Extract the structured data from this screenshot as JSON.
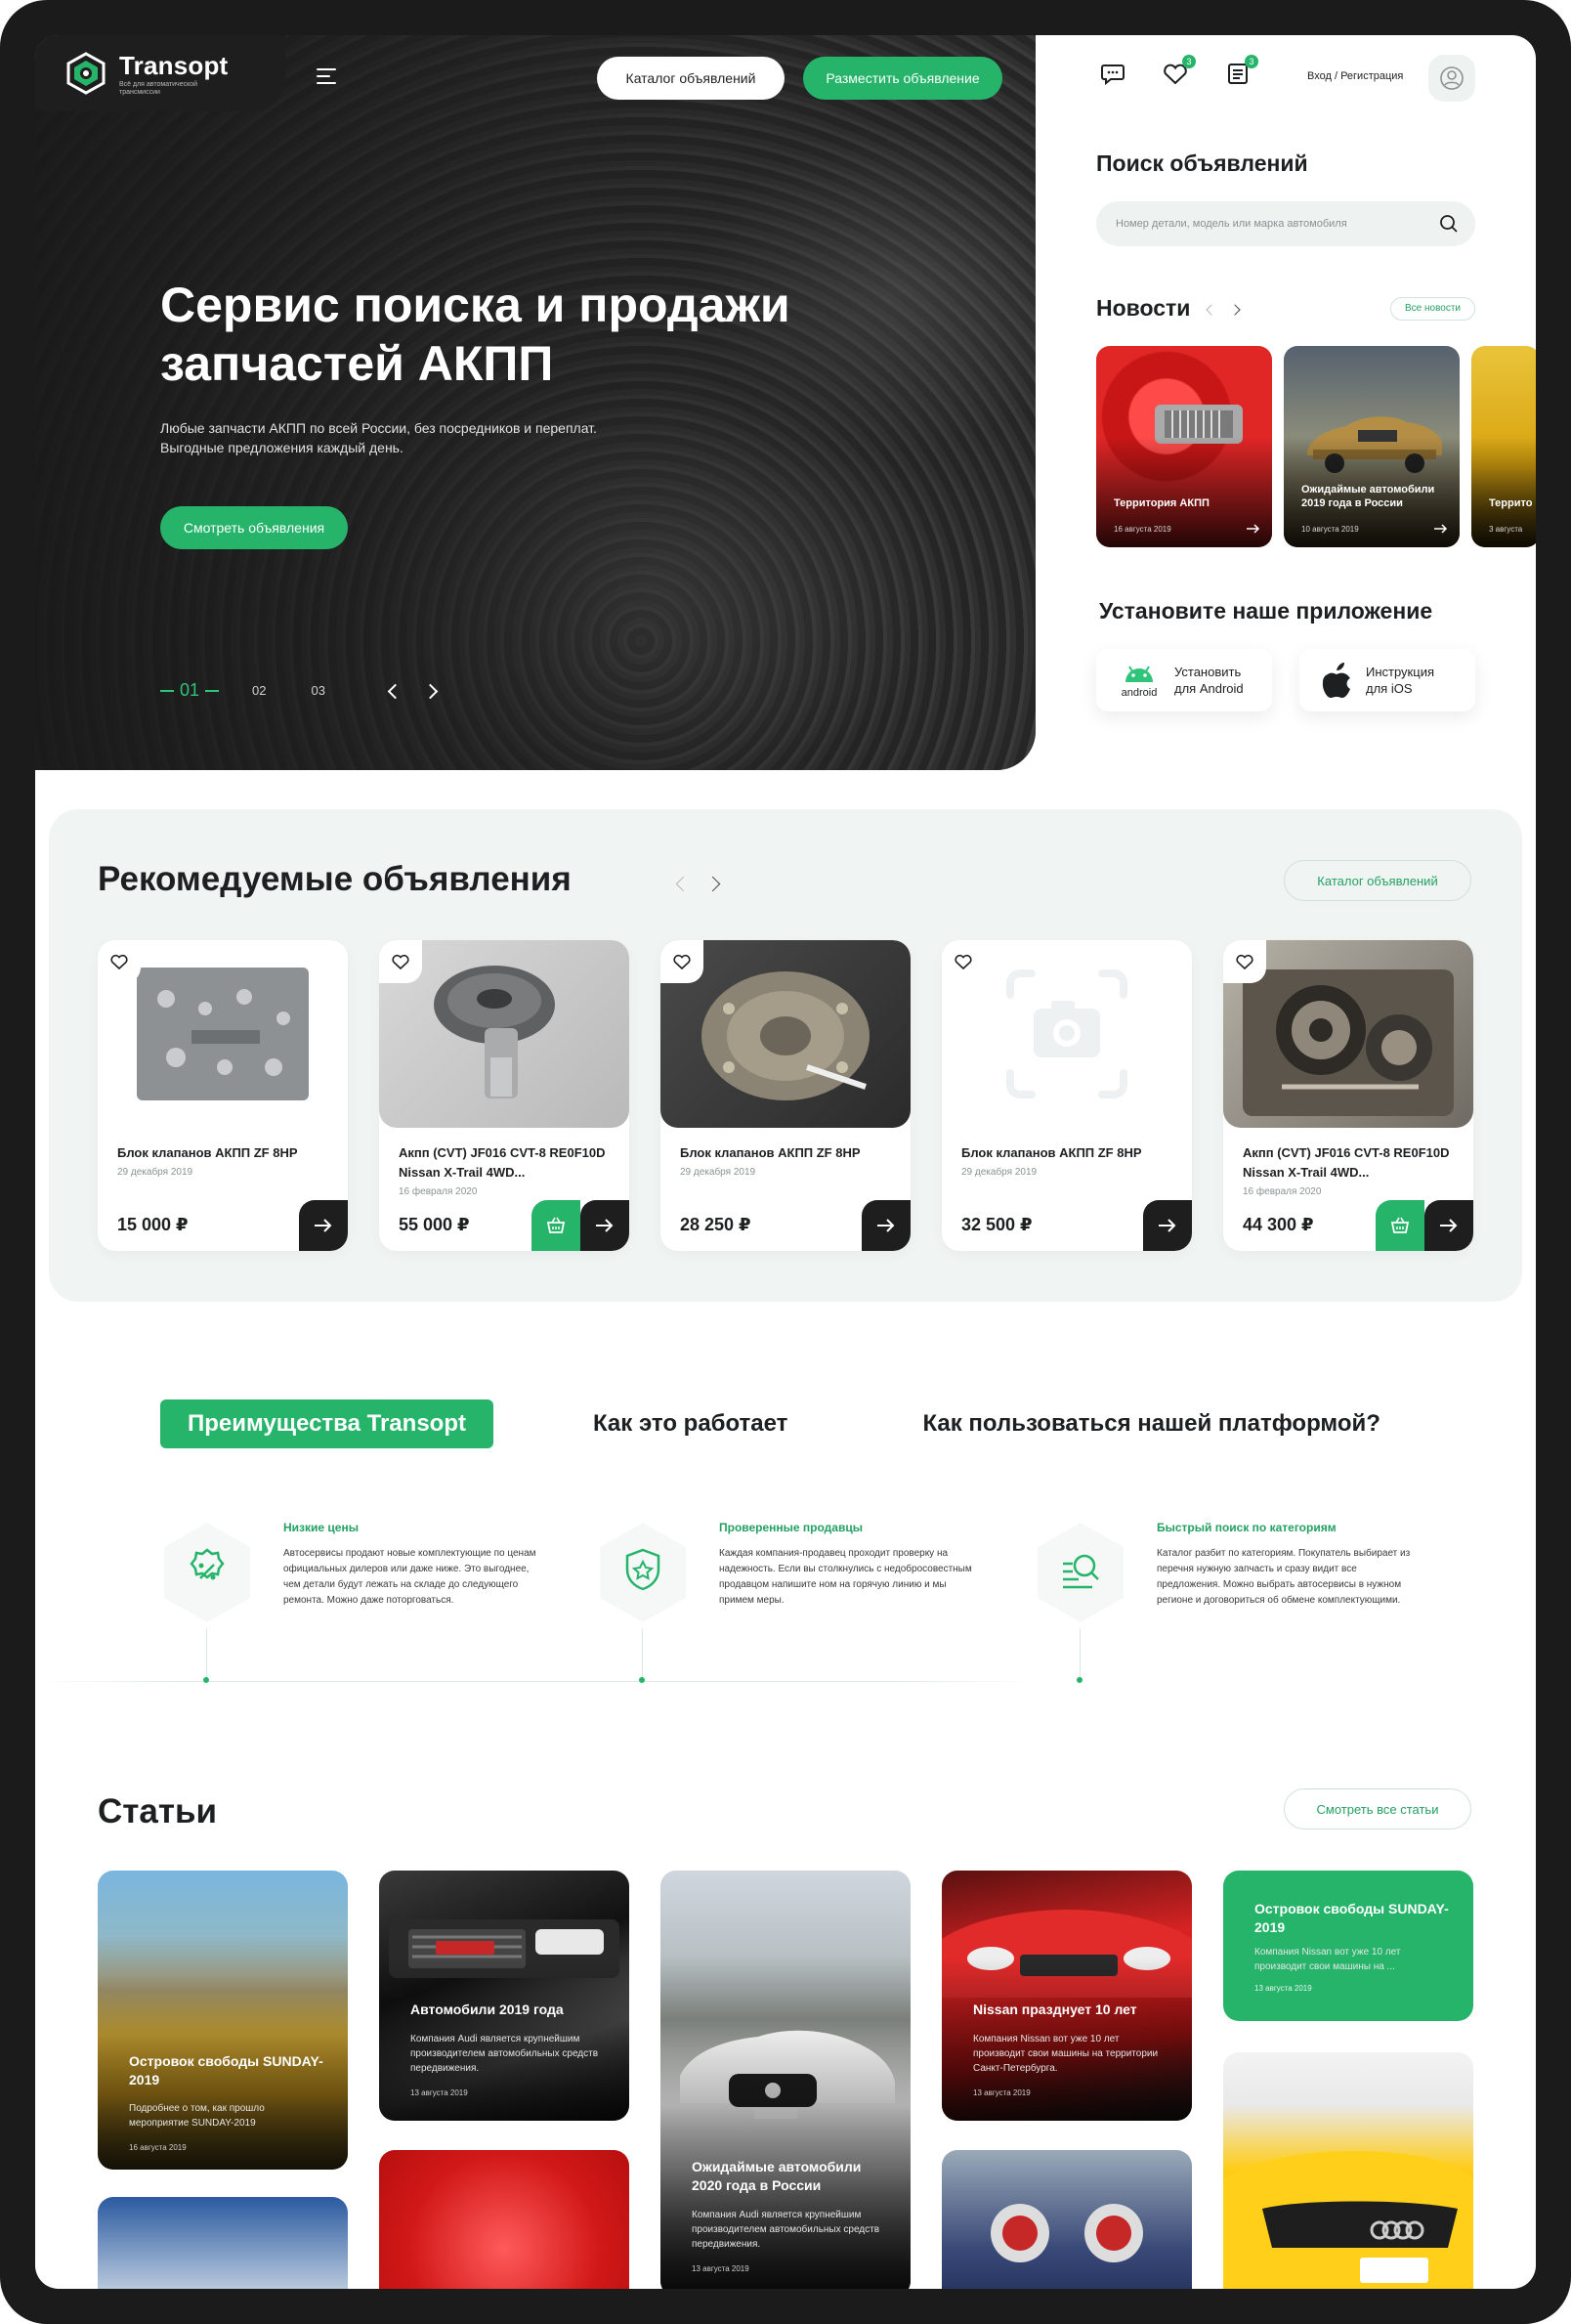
{
  "brand": {
    "name": "Transopt",
    "tagline": "Всё для автоматической трансмиссии",
    "accent": "#25b46a",
    "dark": "#1e1e1e"
  },
  "header": {
    "catalog_btn": "Каталог объявлений",
    "post_btn": "Разместить объявление",
    "icons": [
      "chat-icon",
      "heart-icon",
      "list-icon"
    ],
    "favorites_count": "3",
    "list_count": "3",
    "login_label": "Вход",
    "divider": "/",
    "register_label": "Регистрация"
  },
  "hero": {
    "title": "Сервис поиска и продажи запчастей АКПП",
    "subtitle": "Любые запчасти АКПП по всей России, без посредников и переплат. Выгодные предложения каждый день.",
    "cta": "Смотреть объявления",
    "slides": [
      "01",
      "02",
      "03"
    ],
    "active_slide": "01"
  },
  "search": {
    "title": "Поиск объявлений",
    "placeholder": "Номер детали, модель или марка автомобиля"
  },
  "news": {
    "title": "Новости",
    "all_label": "Все новости",
    "items": [
      {
        "title": "Территория АКПП",
        "date": "16 августа 2019"
      },
      {
        "title": "Ожидаймые автомобили 2019 года в России",
        "date": "10 августа 2019"
      },
      {
        "title": "Террито",
        "date": "3 августа"
      }
    ]
  },
  "app": {
    "title": "Установите наше приложение",
    "android": {
      "icon_text": "android",
      "label": "Установить для Android"
    },
    "ios": {
      "label": "Инструкция для iOS"
    }
  },
  "recommended": {
    "title": "Рекомедуемые объявления",
    "catalog_btn": "Каталог объявлений",
    "items": [
      {
        "title": "Блок клапанов АКПП ZF 8HP",
        "date": "29 декабря 2019",
        "price": "15 000 ₽"
      },
      {
        "title": "Акпп (CVT) JF016 CVT-8 RE0F10D Nissan X-Trail 4WD...",
        "date": "16 февраля 2020",
        "price": "55 000 ₽"
      },
      {
        "title": "Блок клапанов АКПП ZF 8HP",
        "date": "29 декабря 2019",
        "price": "28 250 ₽"
      },
      {
        "title": "Блок клапанов АКПП ZF 8HP",
        "date": "29 декабря 2019",
        "price": "32 500 ₽"
      },
      {
        "title": "Акпп (CVT) JF016 CVT-8 RE0F10D Nissan X-Trail 4WD...",
        "date": "16 февраля 2020",
        "price": "44 300 ₽"
      }
    ]
  },
  "tabs": [
    "Преимущества Transopt",
    "Как это работает",
    "Как пользоваться нашей платформой?"
  ],
  "advantages": [
    {
      "title": "Низкие цены",
      "text": "Автосервисы продают новые комплектующие по ценам официальных дилеров или даже ниже. Это выгоднее, чем детали будут лежать на складе до следующего ремонта. Можно даже поторговаться."
    },
    {
      "title": "Проверенные продавцы",
      "text": "Каждая компания-продавец проходит проверку на надежность. Если вы столкнулись с недобросовестным продавцом напишите ном на горячую линию и мы примем меры."
    },
    {
      "title": "Быстрый поиск по категориям",
      "text": "Каталог разбит по категориям. Покупатель выбирает из перечня нужную запчасть и сразу видит все предложения. Можно выбрать автосервисы в нужном регионе и договориться об обмене комплектующими."
    }
  ],
  "articles": {
    "title": "Статьи",
    "all_btn": "Смотреть все статьи",
    "items": [
      {
        "title": "Островок свободы SUNDAY-2019",
        "text": "Подробнее о том, как прошло мероприятие SUNDAY-2019",
        "date": "16 августа 2019"
      },
      {
        "title": "Автомобили 2019 года",
        "text": "Компания Audi является крупнейшим производителем автомобильных средств передвижения.",
        "date": "13 августа 2019"
      },
      {
        "title": "Ожидаймые автомобили 2020 года в России",
        "text": "Компания Audi является крупнейшим производителем автомобильных средств передвижения.",
        "date": "13 августа 2019"
      },
      {
        "title": "Nissan празднует 10 лет",
        "text": "Компания Nissan вот уже 10 лет производит свои машины на территории Санкт-Петербурга.",
        "date": "13 августа 2019"
      },
      {
        "title": "Островок свободы SUNDAY-2019",
        "text": "Компания Nissan вот уже 10 лет производит свои машины на ...",
        "date": "13 августа 2019"
      }
    ]
  }
}
